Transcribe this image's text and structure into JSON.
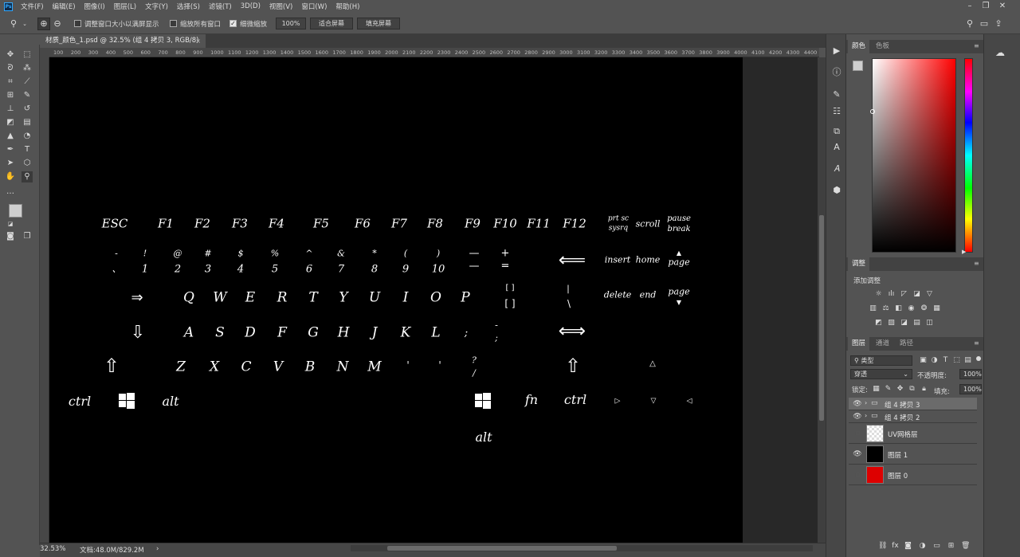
{
  "app": {
    "logo": "Ps"
  },
  "menu": [
    "文件(F)",
    "编辑(E)",
    "图像(I)",
    "图层(L)",
    "文字(Y)",
    "选择(S)",
    "滤镜(T)",
    "3D(D)",
    "视图(V)",
    "窗口(W)",
    "帮助(H)"
  ],
  "options": {
    "chk_resize": "调整窗口大小以满屏显示",
    "chk_all": "缩放所有窗口",
    "chk_scrubby": "细微缩放",
    "zoom_value": "100%",
    "fit_screen": "适合屏幕",
    "fill_screen": "填充屏幕"
  },
  "document": {
    "tab_title": "材质_颜色_1.psd @ 32.5% (组 4 拷贝 3, RGB/8)",
    "close": "×"
  },
  "ruler_ticks": [
    "100",
    "200",
    "300",
    "400",
    "500",
    "600",
    "700",
    "800",
    "900",
    "1000",
    "1100",
    "1200",
    "1300",
    "1400",
    "1500",
    "1600",
    "1700",
    "1800",
    "1900",
    "2000",
    "2100",
    "2200",
    "2300",
    "2400",
    "2500",
    "2600",
    "2700",
    "2800",
    "2900",
    "3000",
    "3100",
    "3200",
    "3300",
    "3400",
    "3500",
    "3600",
    "3700",
    "3800",
    "3900",
    "4000",
    "4100",
    "4200",
    "4300",
    "4400"
  ],
  "keys": {
    "esc": "ESC",
    "f1": "F1",
    "f2": "F2",
    "f3": "F3",
    "f4": "F4",
    "f5": "F5",
    "f6": "F6",
    "f7": "F7",
    "f8": "F8",
    "f9": "F9",
    "f10": "F10",
    "f11": "F11",
    "f12": "F12",
    "prtsc1": "prt sc",
    "prtsc2": "sysrq",
    "scroll": "scroll",
    "pause1": "pause",
    "pause2": "break",
    "tilde_top": "-",
    "tilde_bot": "、",
    "num_top": [
      "!",
      "@",
      "#",
      "$",
      "%",
      "^",
      "&",
      "*",
      "(",
      ")"
    ],
    "num_bot": [
      "1",
      "2",
      "3",
      "4",
      "5",
      "6",
      "7",
      "8",
      "9",
      "10"
    ],
    "minus_top": "—",
    "minus_bot": "—",
    "plus_top": "+",
    "plus_bot": "=",
    "backspace": "⟸",
    "insert": "insert",
    "home": "home",
    "pgup_arrow": "▲",
    "pgup": "page",
    "tab": "⇒",
    "row_q": [
      "Q",
      "W",
      "E",
      "R",
      "T",
      "Y",
      "U",
      "I",
      "O",
      "P"
    ],
    "bracket_top": "[        ]",
    "bracket_bot": "[        ]",
    "pipe_top": "|",
    "pipe_bot": "\\",
    "delete": "delete",
    "end": "end",
    "pgdn": "page",
    "pgdn_arrow": "▼",
    "caps": "⇩",
    "row_a": [
      "A",
      "S",
      "D",
      "F",
      "G",
      "H",
      "J",
      "K",
      "L"
    ],
    "semi": ";",
    "quote_top": "-",
    "quote_bot": ";",
    "enter": "⟺",
    "shift_l": "⇧",
    "row_z": [
      "Z",
      "X",
      "C",
      "V",
      "B",
      "N",
      "M"
    ],
    "comma": "'",
    "period": "'",
    "slash_top": "?",
    "slash_bot": "/",
    "shift_r": "⇧",
    "up": "△",
    "ctrl_l": "ctrl",
    "alt_l": "alt",
    "fn": "fn",
    "ctrl_r": "ctrl",
    "left": "▷",
    "down": "▽",
    "right": "◁",
    "alt_r": "alt"
  },
  "status": {
    "zoom": "32.53%",
    "doc": "文档:48.0M/829.2M",
    "arrow": "›"
  },
  "panels": {
    "color_tabs": [
      "颜色",
      "色板"
    ],
    "adjust_tab": "调整",
    "adjust_label": "添加调整",
    "layer_tabs": [
      "图层",
      "通道",
      "路径"
    ],
    "filter_kind": "类型",
    "blend_mode": "穿透",
    "opacity_label": "不透明度:",
    "opacity_value": "100%",
    "lock_label": "锁定:",
    "fill_label": "填充:",
    "fill_value": "100%",
    "layers": [
      {
        "name": "组 4 拷贝 3"
      },
      {
        "name": "组 4 拷贝 2"
      },
      {
        "name": "UV网格层"
      },
      {
        "name": "图层 1"
      },
      {
        "name": "图层 0"
      }
    ]
  },
  "colors": {
    "accent": "#31a8ff",
    "layer0": "#dd0000"
  }
}
